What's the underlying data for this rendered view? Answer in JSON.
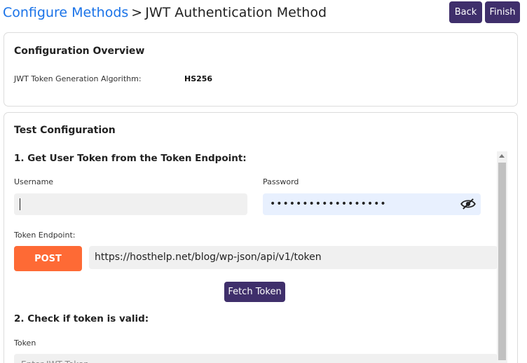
{
  "header": {
    "breadcrumb_link": "Configure Methods",
    "separator": ">",
    "current": "JWT Authentication Method",
    "back_label": "Back",
    "finish_label": "Finish"
  },
  "overview": {
    "title": "Configuration Overview",
    "algorithm_label": "JWT Token Generation Algorithm:",
    "algorithm_value": "HS256"
  },
  "test": {
    "title": "Test Configuration",
    "step1_title": "1. Get User Token from the Token Endpoint:",
    "username_label": "Username",
    "username_value": "",
    "password_label": "Password",
    "password_value": "••••••••••••••••••",
    "endpoint_label": "Token Endpoint:",
    "method_label": "POST",
    "endpoint_url": "https://hosthelp.net/blog/wp-json/api/v1/token",
    "fetch_label": "Fetch Token",
    "step2_title": "2. Check if token is valid:",
    "token_label": "Token",
    "token_placeholder": "Enter JWT Token"
  },
  "icons": {
    "password_toggle": "eye-slash-icon",
    "scroll_up": "scroll-up-arrow-icon"
  },
  "colors": {
    "accent": "#3f2f6b",
    "link": "#1a73e8",
    "post": "#fe6a35"
  }
}
